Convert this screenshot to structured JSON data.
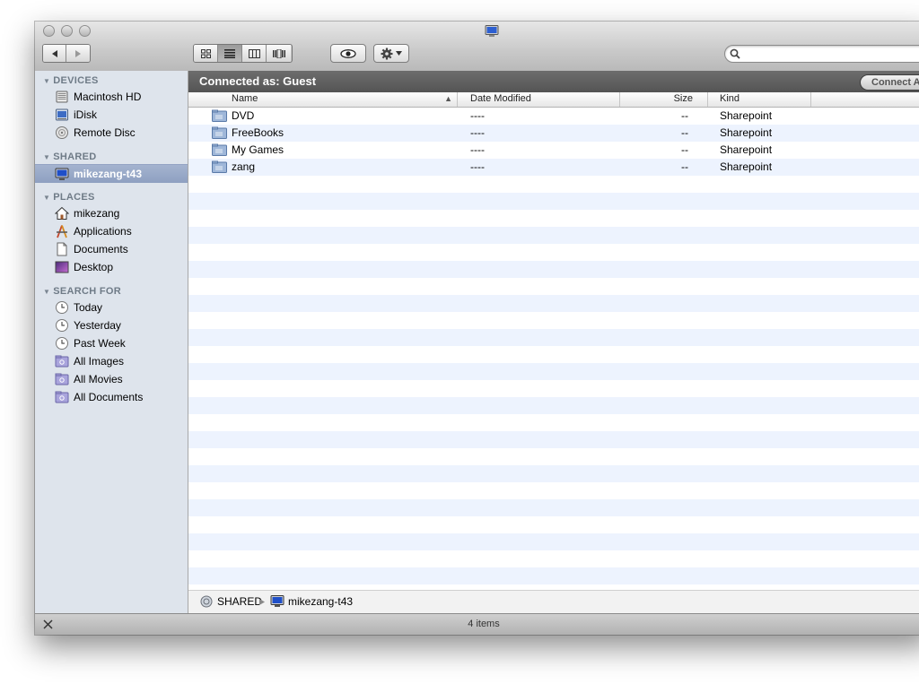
{
  "window": {
    "title_icon": "computer-icon"
  },
  "toolbar": {
    "back_icon": "back-arrow-icon",
    "forward_icon": "forward-arrow-icon",
    "view_modes": [
      "icon-view-icon",
      "list-view-icon",
      "column-view-icon",
      "coverflow-view-icon"
    ],
    "active_view": "list-view-icon",
    "quicklook_icon": "eye-icon",
    "action_icon": "gear-icon",
    "search_placeholder": ""
  },
  "sidebar": {
    "sections": [
      {
        "header": "DEVICES",
        "items": [
          {
            "label": "Macintosh HD",
            "icon": "hard-drive-icon"
          },
          {
            "label": "iDisk",
            "icon": "idisk-icon"
          },
          {
            "label": "Remote Disc",
            "icon": "remote-disc-icon"
          }
        ]
      },
      {
        "header": "SHARED",
        "items": [
          {
            "label": "mikezang-t43",
            "icon": "computer-icon",
            "selected": true
          }
        ]
      },
      {
        "header": "PLACES",
        "items": [
          {
            "label": "mikezang",
            "icon": "home-icon"
          },
          {
            "label": "Applications",
            "icon": "applications-icon"
          },
          {
            "label": "Documents",
            "icon": "document-icon"
          },
          {
            "label": "Desktop",
            "icon": "desktop-icon"
          }
        ]
      },
      {
        "header": "SEARCH FOR",
        "items": [
          {
            "label": "Today",
            "icon": "clock-icon"
          },
          {
            "label": "Yesterday",
            "icon": "clock-icon"
          },
          {
            "label": "Past Week",
            "icon": "clock-icon"
          },
          {
            "label": "All Images",
            "icon": "smart-folder-icon"
          },
          {
            "label": "All Movies",
            "icon": "smart-folder-icon"
          },
          {
            "label": "All Documents",
            "icon": "smart-folder-icon"
          }
        ]
      }
    ]
  },
  "connection": {
    "status": "Connected as: Guest",
    "button_label": "Connect As..."
  },
  "columns": {
    "name": "Name",
    "date_modified": "Date Modified",
    "size": "Size",
    "kind": "Kind",
    "sort_indicator": "▲"
  },
  "files": [
    {
      "name": "DVD",
      "date_modified": "----",
      "size": "--",
      "kind": "Sharepoint",
      "icon": "shared-folder-icon"
    },
    {
      "name": "FreeBooks",
      "date_modified": "----",
      "size": "--",
      "kind": "Sharepoint",
      "icon": "shared-folder-icon"
    },
    {
      "name": "My Games",
      "date_modified": "----",
      "size": "--",
      "kind": "Sharepoint",
      "icon": "shared-folder-icon"
    },
    {
      "name": "zang",
      "date_modified": "----",
      "size": "--",
      "kind": "Sharepoint",
      "icon": "shared-folder-icon"
    }
  ],
  "path_bar": [
    {
      "label": "SHARED",
      "icon": "network-icon"
    },
    {
      "label": "mikezang-t43",
      "icon": "computer-icon"
    }
  ],
  "status": {
    "item_count": "4 items"
  },
  "colors": {
    "sidebar_bg": "#dee4ec",
    "sidebar_selected": "#98a9c8",
    "header_dark": "#5e5e5e",
    "row_stripe": "#edf3fe"
  }
}
